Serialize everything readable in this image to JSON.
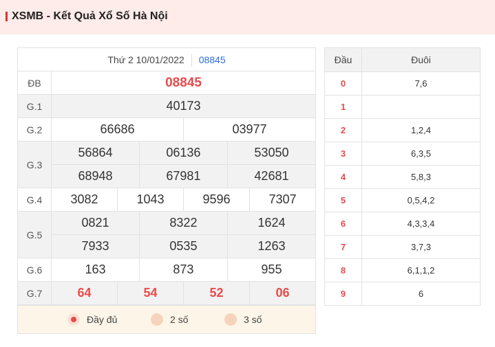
{
  "header": {
    "title": "XSMB - Kết Quả Xổ Số Hà Nội"
  },
  "draw": {
    "date": "Thứ 2 10/01/2022",
    "code": "08845"
  },
  "results": {
    "db": {
      "label": "ĐB",
      "numbers": [
        "08845"
      ]
    },
    "g1": {
      "label": "G.1",
      "numbers": [
        "40173"
      ]
    },
    "g2": {
      "label": "G.2",
      "numbers": [
        "66686",
        "03977"
      ]
    },
    "g3": {
      "label": "G.3",
      "numbers": [
        "56864",
        "06136",
        "53050",
        "68948",
        "67981",
        "42681"
      ]
    },
    "g4": {
      "label": "G.4",
      "numbers": [
        "3082",
        "1043",
        "9596",
        "7307"
      ]
    },
    "g5": {
      "label": "G.5",
      "numbers": [
        "0821",
        "8322",
        "1624",
        "7933",
        "0535",
        "1263"
      ]
    },
    "g6": {
      "label": "G.6",
      "numbers": [
        "163",
        "873",
        "955"
      ]
    },
    "g7": {
      "label": "G.7",
      "numbers": [
        "64",
        "54",
        "52",
        "06"
      ]
    }
  },
  "options": {
    "full_label": "Đầy đủ",
    "two_label": "2 số",
    "three_label": "3 số",
    "selected": "Đầy đủ"
  },
  "loto": {
    "head_label": "Đầu",
    "tail_label": "Đuôi",
    "rows": [
      {
        "head": "0",
        "tail": "7,6"
      },
      {
        "head": "1",
        "tail": ""
      },
      {
        "head": "2",
        "tail": "1,2,4"
      },
      {
        "head": "3",
        "tail": "6,3,5"
      },
      {
        "head": "4",
        "tail": "5,8,3"
      },
      {
        "head": "5",
        "tail": "0,5,4,2"
      },
      {
        "head": "6",
        "tail": "4,3,3,4"
      },
      {
        "head": "7",
        "tail": "3,7,3"
      },
      {
        "head": "8",
        "tail": "6,1,1,2"
      },
      {
        "head": "9",
        "tail": "6"
      }
    ]
  },
  "colors": {
    "accent": "#e84b4b",
    "link": "#2a6fdb",
    "header_bg": "#fdecea",
    "option_bg": "#fdf6e8"
  }
}
